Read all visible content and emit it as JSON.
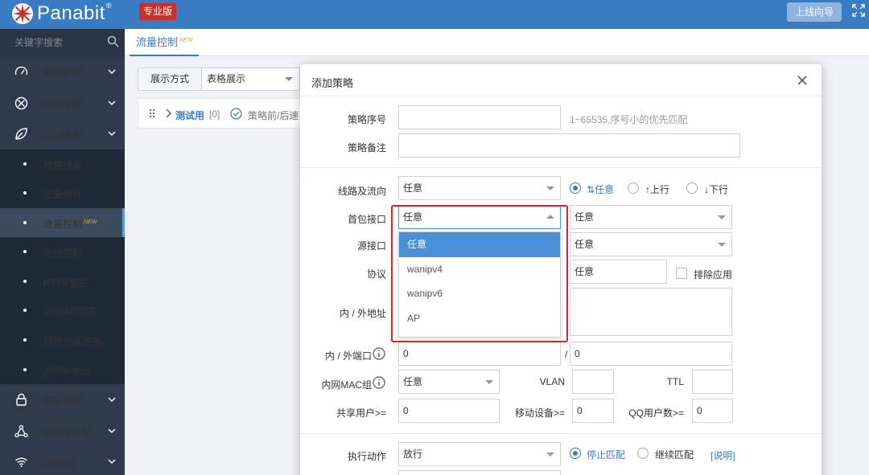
{
  "header": {
    "brand": "Panabit",
    "brand_reg": "®",
    "edition": "专业版",
    "wizard_button": "上线向导",
    "colors": {
      "bar": "#3a7cc4",
      "badge": "#c9302c"
    }
  },
  "sidebar": {
    "search_placeholder": "关键字搜索",
    "groups": [
      {
        "label": "系统概况",
        "icon": "speedometer-icon"
      },
      {
        "label": "网络设置",
        "icon": "globe-cross-icon"
      },
      {
        "label": "行为管理",
        "icon": "leaf-icon"
      }
    ],
    "sub_items": [
      {
        "label": "数据通道"
      },
      {
        "label": "流量统计"
      },
      {
        "label": "流量控制",
        "tag": "NEW",
        "active": true
      },
      {
        "label": "连接控制"
      },
      {
        "label": "HTTP管控"
      },
      {
        "label": "IP/MAC绑定"
      },
      {
        "label": "网络分享控制"
      },
      {
        "label": "内网IP统计"
      }
    ],
    "groups_bottom": [
      {
        "label": "虚拟专网",
        "icon": "vpn-icon"
      },
      {
        "label": "服务器负载",
        "icon": "network-icon"
      },
      {
        "label": "无线AC",
        "icon": "wifi-icon"
      }
    ]
  },
  "main": {
    "tab": "流量控制",
    "tab_tag": "NEW",
    "view_label": "展示方式",
    "view_value": "表格展示",
    "policy_name": "测试用",
    "policy_count": "[0]",
    "policy_desc": "策略前/后速"
  },
  "modal": {
    "title": "添加策略",
    "fields": {
      "seq_label": "策略序号",
      "seq_value": "",
      "seq_hint": "1~65535,序号小的优先匹配",
      "note_label": "策略备注",
      "note_value": "",
      "line_label": "线路及流向",
      "line_value": "任意",
      "dir_any": "⇅任意",
      "dir_up": "↑上行",
      "dir_down": "↓下行",
      "first_if_label": "首包接口",
      "first_if_value": "任意",
      "first_if_value2": "任意",
      "src_if_label": "源接口",
      "src_if_value2": "任意",
      "proto_label": "协议",
      "proto_value": "任意",
      "exclude_app": "排除应用",
      "addr_label": "内 / 外地址",
      "port_label": "内 / 外端口",
      "port_in": "0",
      "port_slash": "/",
      "port_out": "0",
      "mac_label": "内网MAC组",
      "mac_value": "任意",
      "vlan_label": "VLAN",
      "vlan_value": "",
      "ttl_label": "TTL",
      "ttl_value": "",
      "share_label": "共享用户>=",
      "share_value": "0",
      "mobile_label": "移动设备>=",
      "mobile_value": "0",
      "qq_label": "QQ用户数>=",
      "qq_value": "0",
      "action_label": "执行动作",
      "action_value": "放行",
      "stop_match": "停止匹配",
      "continue_match": "继续匹配",
      "explain": "[说明]"
    },
    "dropdown_options": [
      "任意",
      "wanipv4",
      "wanipv6",
      "AP"
    ],
    "dropdown_selected": "任意"
  }
}
